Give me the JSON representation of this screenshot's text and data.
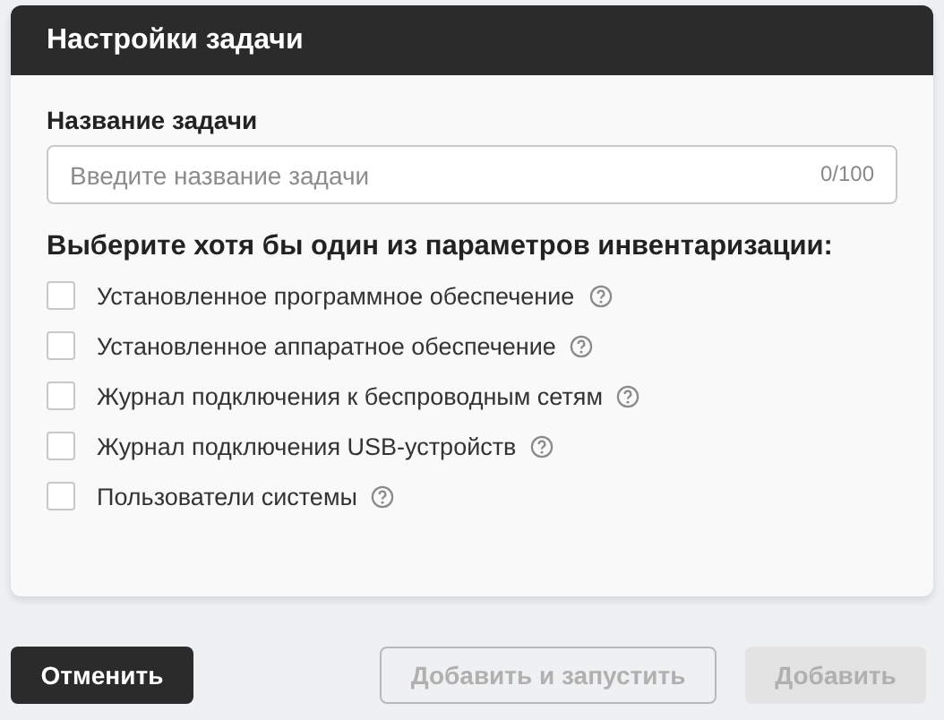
{
  "dialog": {
    "title": "Настройки задачи"
  },
  "name_field": {
    "label": "Название задачи",
    "placeholder": "Введите название задачи",
    "counter": "0/100"
  },
  "options_heading": "Выберите хотя бы один из параметров инвентаризации:",
  "options": [
    {
      "label": "Установленное программное обеспечение",
      "checked": false
    },
    {
      "label": "Установленное аппаратное обеспечение",
      "checked": false
    },
    {
      "label": "Журнал подключения к беспроводным сетям",
      "checked": false
    },
    {
      "label": "Журнал подключения USB-устройств",
      "checked": false
    },
    {
      "label": "Пользователи системы",
      "checked": false
    }
  ],
  "buttons": [
    {
      "label": "Отменить",
      "kind": "primary",
      "disabled": false
    },
    {
      "label": "Добавить и запустить",
      "kind": "outline",
      "disabled": true
    },
    {
      "label": "Добавить",
      "kind": "filled",
      "disabled": true
    }
  ]
}
